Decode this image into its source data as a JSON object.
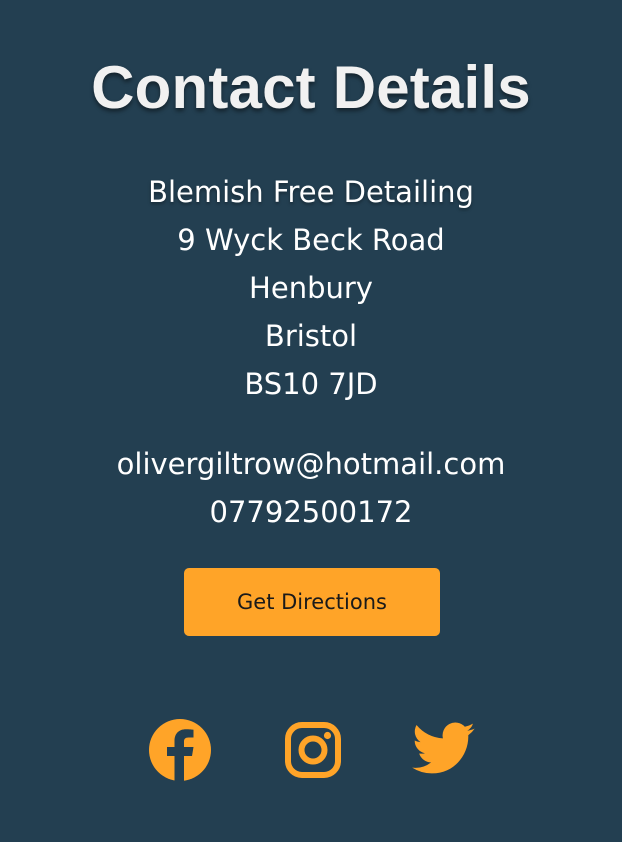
{
  "title": "Contact Details",
  "address": {
    "company": "Blemish Free Detailing",
    "street": "9 Wyck Beck Road",
    "area": "Henbury",
    "city": "Bristol",
    "postcode": "BS10 7JD"
  },
  "contact": {
    "email": "olivergiltrow@hotmail.com",
    "phone": "07792500172"
  },
  "directions_button": {
    "label": "Get Directions"
  },
  "social": [
    {
      "icon": "facebook-icon"
    },
    {
      "icon": "instagram-icon"
    },
    {
      "icon": "twitter-icon"
    }
  ],
  "colors": {
    "background": "#233f51",
    "accent": "#ffa428",
    "text": "#ffffff"
  }
}
